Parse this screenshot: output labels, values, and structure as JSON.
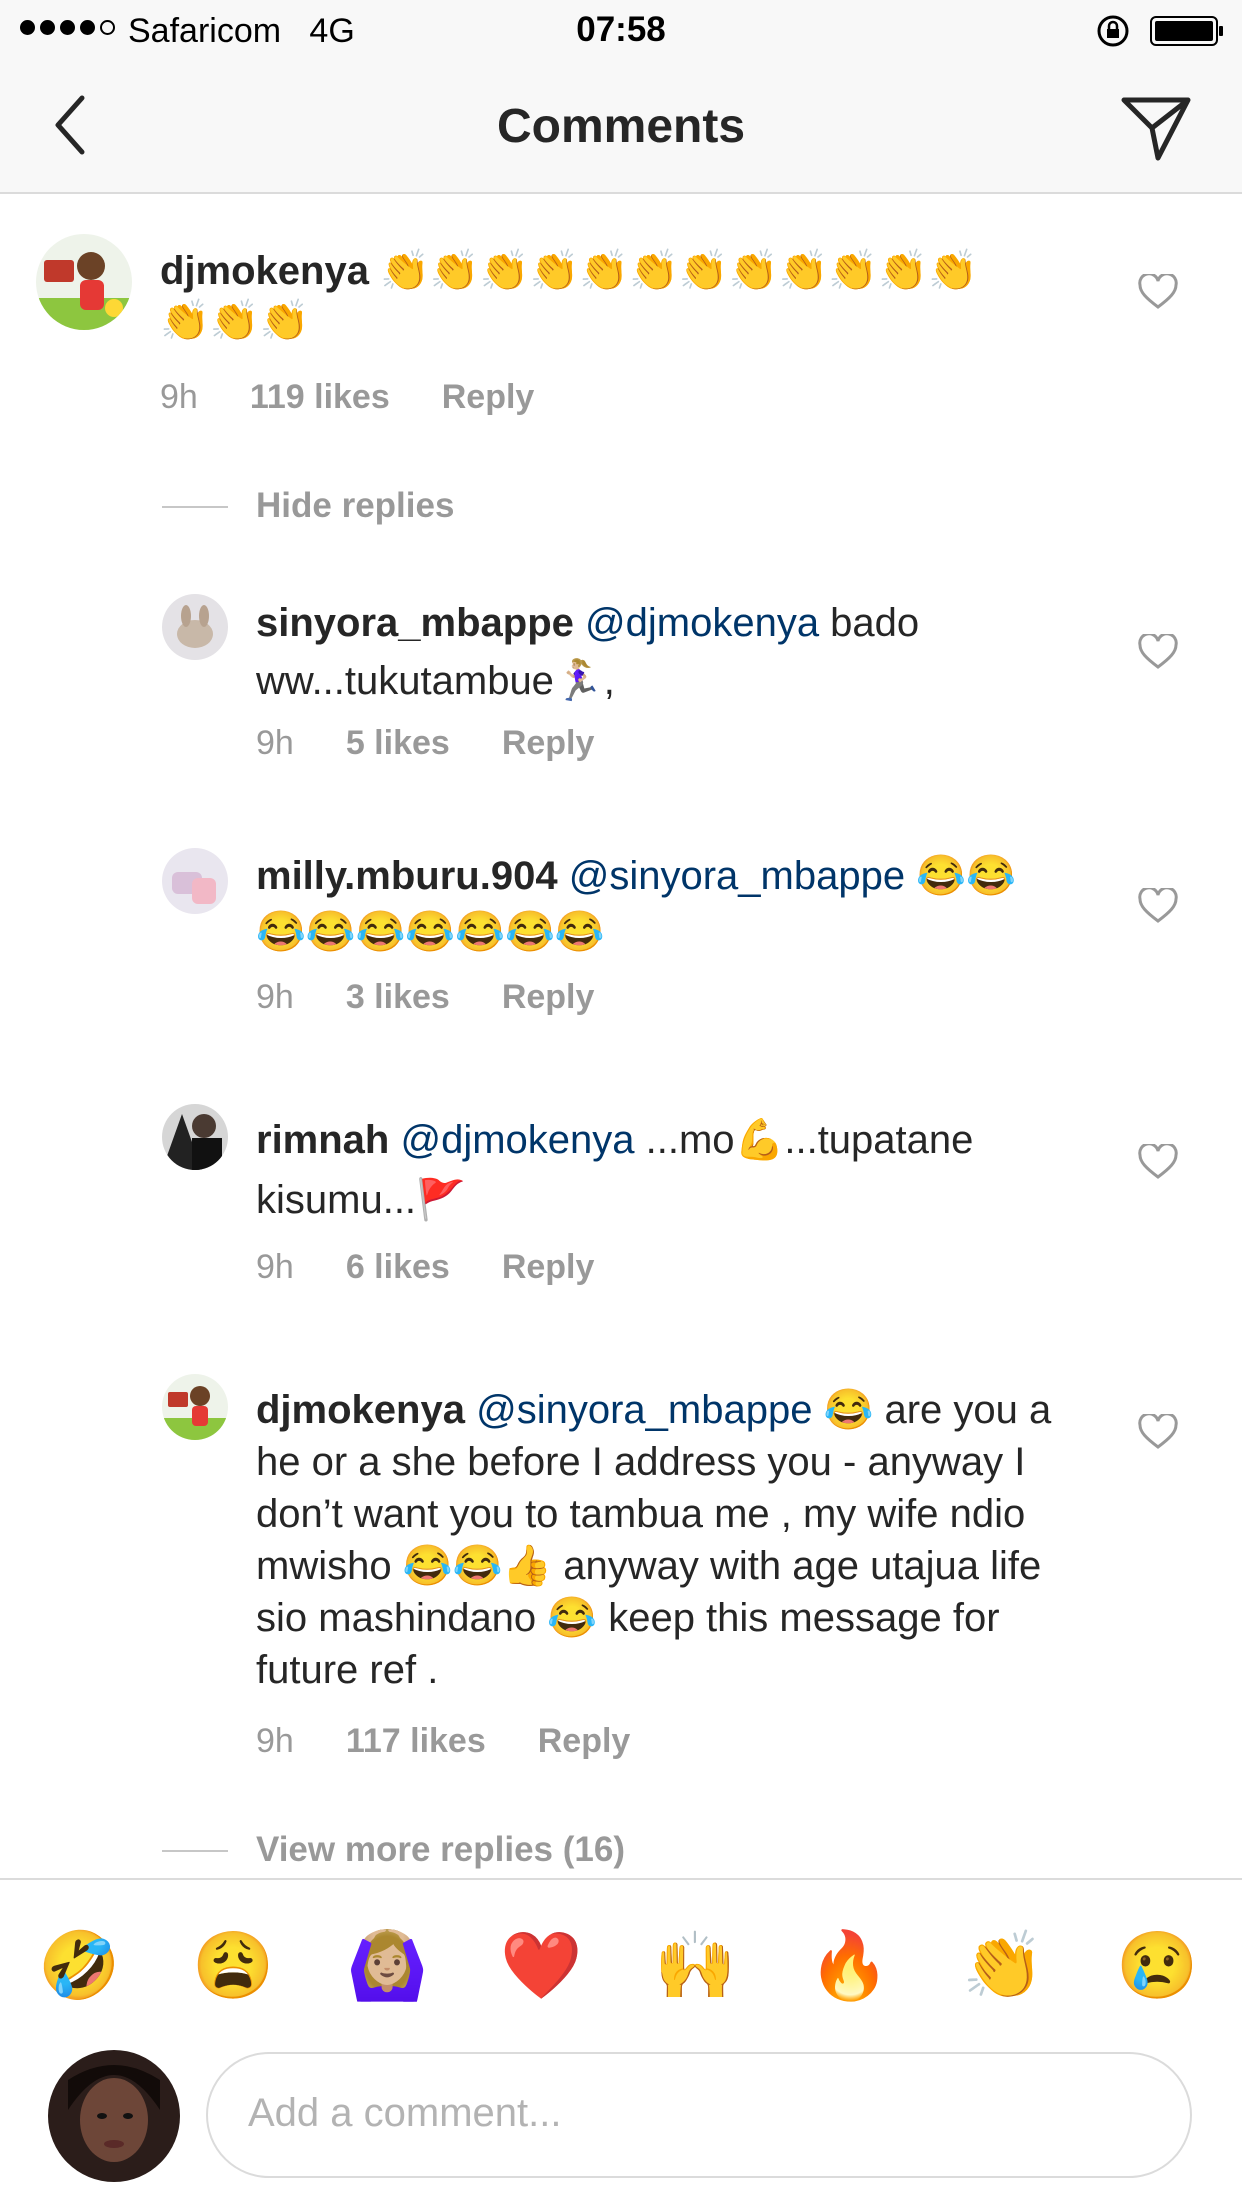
{
  "status_bar": {
    "carrier": "Safaricom",
    "network": "4G",
    "time": "07:58"
  },
  "header": {
    "title": "Comments"
  },
  "comments": [
    {
      "user": "djmokenya",
      "mention": "",
      "text": "👏👏👏👏👏👏👏👏👏👏👏👏👏👏👏",
      "age": "9h",
      "likes": "119 likes",
      "reply": "Reply"
    },
    {
      "user": "sinyora_mbappe",
      "mention": "@djmokenya",
      "text": " bado ww...tukutambue🏃🏼‍♀️,",
      "age": "9h",
      "likes": "5 likes",
      "reply": "Reply"
    },
    {
      "user": "milly.mburu.904",
      "mention": "@sinyora_mbappe",
      "text": " 😂😂😂😂😂😂😂😂😂",
      "age": "9h",
      "likes": "3 likes",
      "reply": "Reply"
    },
    {
      "user": "rimnah",
      "mention": "@djmokenya",
      "text": " ...mo💪...tupatane kisumu...🚩",
      "age": "9h",
      "likes": "6 likes",
      "reply": "Reply"
    },
    {
      "user": "djmokenya",
      "mention": "@sinyora_mbappe",
      "text": " 😂 are you a he or a she before I address you - anyway I don’t want you to tambua me , my wife ndio mwisho 😂😂👍 anyway with age utajua life sio mashindano 😂 keep this message for future ref .",
      "age": "9h",
      "likes": "117 likes",
      "reply": "Reply"
    }
  ],
  "hide_replies": "Hide replies",
  "view_more_replies": "View more replies (16)",
  "emoji_bar": [
    "🤣",
    "😩",
    "🙆🏼‍♀️",
    "❤️",
    "🙌",
    "🔥",
    "👏",
    "😢"
  ],
  "input": {
    "placeholder": "Add a comment..."
  },
  "colors": {
    "mention": "#003569",
    "meta": "#999999",
    "text": "#262626",
    "divider": "#dbdbdb"
  }
}
